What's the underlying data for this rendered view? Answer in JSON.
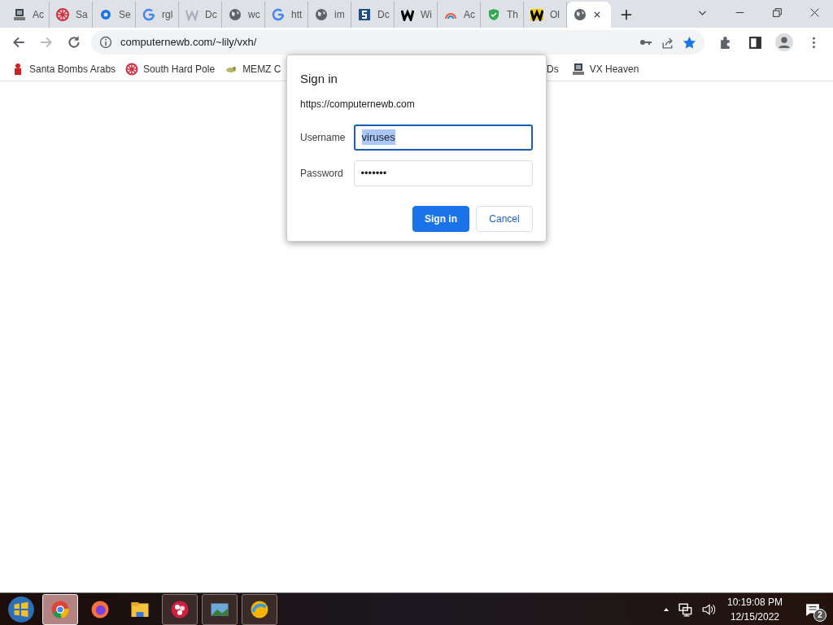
{
  "tabs": [
    {
      "label": "Ac",
      "selected": false
    },
    {
      "label": "Sa",
      "selected": false
    },
    {
      "label": "Se",
      "selected": false
    },
    {
      "label": "rgl",
      "selected": false
    },
    {
      "label": "Dc",
      "selected": false
    },
    {
      "label": "wc",
      "selected": false
    },
    {
      "label": "htt",
      "selected": false
    },
    {
      "label": "im",
      "selected": false
    },
    {
      "label": "Dc",
      "selected": false
    },
    {
      "label": "Wi",
      "selected": false
    },
    {
      "label": "Ac",
      "selected": false
    },
    {
      "label": "Th",
      "selected": false
    },
    {
      "label": "Ol",
      "selected": false
    },
    {
      "selected": true
    }
  ],
  "address_bar": {
    "url": "computernewb.com/~lily/vxh/",
    "bookmarked": true
  },
  "bookmarks": [
    {
      "label": "Santa Bombs Arabs"
    },
    {
      "label": "South Hard Pole"
    },
    {
      "label": "MEMZ C"
    },
    {
      "label": "Ds"
    },
    {
      "label": "VX Heaven"
    }
  ],
  "dialog": {
    "title": "Sign in",
    "origin": "https://computernewb.com",
    "fields": [
      {
        "label": "Username",
        "value": "viruses",
        "focused": true
      },
      {
        "label": "Password",
        "value": "•••••••",
        "focused": false
      }
    ],
    "buttons": [
      {
        "label": "Sign in",
        "kind": "primary"
      },
      {
        "label": "Cancel",
        "kind": "secondary"
      }
    ]
  },
  "taskbar": {
    "apps": [
      {
        "running": false,
        "selected": true
      },
      {
        "running": false,
        "selected": false
      },
      {
        "running": false,
        "selected": false
      },
      {
        "running": true,
        "selected": false
      },
      {
        "running": true,
        "selected": false
      },
      {
        "running": true,
        "selected": false
      }
    ],
    "time": "10:19:08 PM",
    "date": "12/15/2022",
    "notifications": "2"
  }
}
